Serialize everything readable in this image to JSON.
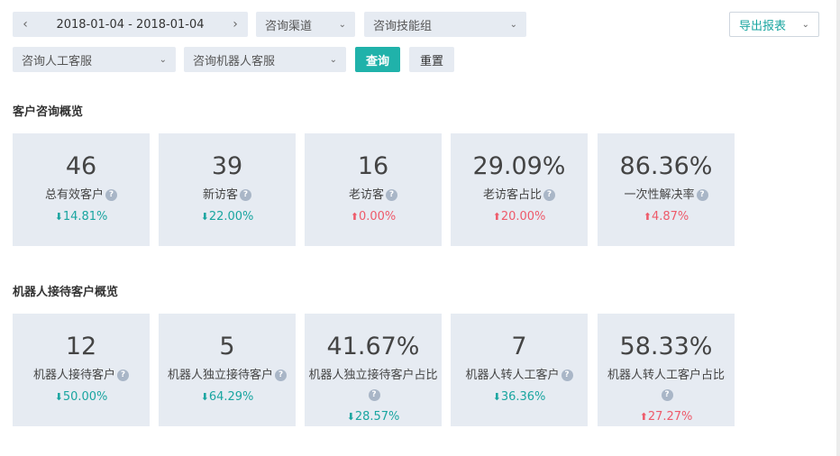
{
  "filters": {
    "date_range": "2018-01-04 - 2018-01-04",
    "prev_symbol": "‹",
    "next_symbol": "›",
    "channel_placeholder": "咨询渠道",
    "skill_group_placeholder": "咨询技能组",
    "human_agent_placeholder": "咨询人工客服",
    "robot_agent_placeholder": "咨询机器人客服",
    "query_label": "查询",
    "reset_label": "重置",
    "export_label": "导出报表"
  },
  "icons": {
    "help": "question-circle-icon",
    "down": "arrow-down-icon",
    "up": "arrow-up-icon",
    "dropdown": "chevron-down-icon"
  },
  "colors": {
    "primary": "#20b2aa",
    "down": "#1aa5a0",
    "up": "#ee5a6a",
    "card_bg": "#e6ebf2"
  },
  "overview": {
    "title": "客户咨询概览",
    "cards": [
      {
        "value": "46",
        "name": "总有效客户",
        "change": "14.81%",
        "direction": "down"
      },
      {
        "value": "39",
        "name": "新访客",
        "change": "22.00%",
        "direction": "down"
      },
      {
        "value": "16",
        "name": "老访客",
        "change": "0.00%",
        "direction": "up"
      },
      {
        "value": "29.09%",
        "name": "老访客占比",
        "change": "20.00%",
        "direction": "up"
      },
      {
        "value": "86.36%",
        "name": "一次性解决率",
        "change": "4.87%",
        "direction": "up"
      }
    ]
  },
  "robot": {
    "title": "机器人接待客户概览",
    "cards": [
      {
        "value": "12",
        "name": "机器人接待客户",
        "change": "50.00%",
        "direction": "down"
      },
      {
        "value": "5",
        "name": "机器人独立接待客户",
        "change": "64.29%",
        "direction": "down"
      },
      {
        "value": "41.67%",
        "name": "机器人独立接待客户占比",
        "change": "28.57%",
        "direction": "down"
      },
      {
        "value": "7",
        "name": "机器人转人工客户",
        "change": "36.36%",
        "direction": "down"
      },
      {
        "value": "58.33%",
        "name": "机器人转人工客户占比",
        "change": "27.27%",
        "direction": "up"
      }
    ]
  }
}
